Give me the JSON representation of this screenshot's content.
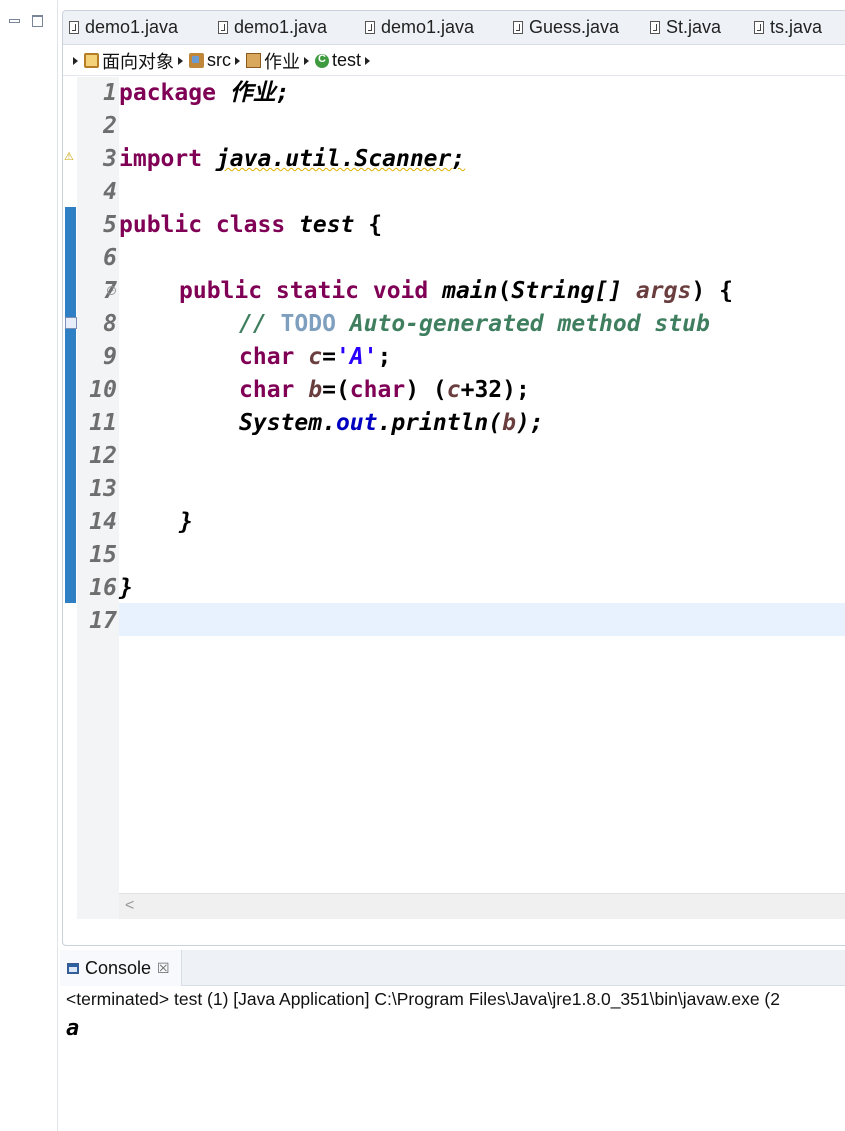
{
  "tabs": [
    {
      "label": "demo1.java"
    },
    {
      "label": "demo1.java"
    },
    {
      "label": "demo1.java"
    },
    {
      "label": "Guess.java"
    },
    {
      "label": "St.java"
    },
    {
      "label": "ts.java"
    }
  ],
  "breadcrumb": {
    "project": "面向对象",
    "source_folder": "src",
    "package": "作业",
    "class": "test"
  },
  "editor": {
    "line_numbers": [
      "1",
      "2",
      "3",
      "4",
      "5",
      "6",
      "7",
      "8",
      "9",
      "10",
      "11",
      "12",
      "13",
      "14",
      "15",
      "16",
      "17"
    ],
    "lines": {
      "l1_kw": "package",
      "l1_pkg": " 作业;",
      "l3_kw": "import",
      "l3_rest": "java.util.Scanner;",
      "l5_kw": "public class",
      "l5_name": " test",
      "l5_brace": " {",
      "l7_kw": "public static void",
      "l7_method": " main",
      "l7_paren": "(",
      "l7_type": "String[]",
      "l7_param": " args",
      "l7_close": ") {",
      "l8_comment_start": "// ",
      "l8_todo": "TODO",
      "l8_comment_rest": " Auto-generated method stub",
      "l9_kw": "char",
      "l9_var": " c",
      "l9_eq": "=",
      "l9_str": "'A'",
      "l9_end": ";",
      "l10_kw": "char",
      "l10_var": " b",
      "l10_eq": "=(",
      "l10_kw2": "char",
      "l10_mid": ") (",
      "l10_var2": "c",
      "l10_end": "+32);",
      "l11_sys": "System.",
      "l11_out": "out",
      "l11_print": ".println(",
      "l11_var": "b",
      "l11_end": ");",
      "l14": "}",
      "l16": "}"
    }
  },
  "console": {
    "tab_label": "Console",
    "close_symbol": "☒",
    "status": "<terminated> test (1) [Java Application] C:\\Program Files\\Java\\jre1.8.0_351\\bin\\javaw.exe (2",
    "output": "a"
  },
  "colors": {
    "keyword": "#7f0055",
    "string": "#2a00ff",
    "comment": "#3f7f5f",
    "local_var": "#6a3e3e",
    "field": "#0000c0",
    "change_bar": "#2f7fc4",
    "current_line": "#e8f2fe"
  },
  "icons": {
    "minimize": "minimize-icon",
    "maximize": "maximize-icon",
    "file": "java-file-icon",
    "project": "project-icon",
    "source_folder": "source-folder-icon",
    "package": "package-icon",
    "class": "class-icon",
    "console": "console-icon",
    "warning": "warning-icon"
  }
}
